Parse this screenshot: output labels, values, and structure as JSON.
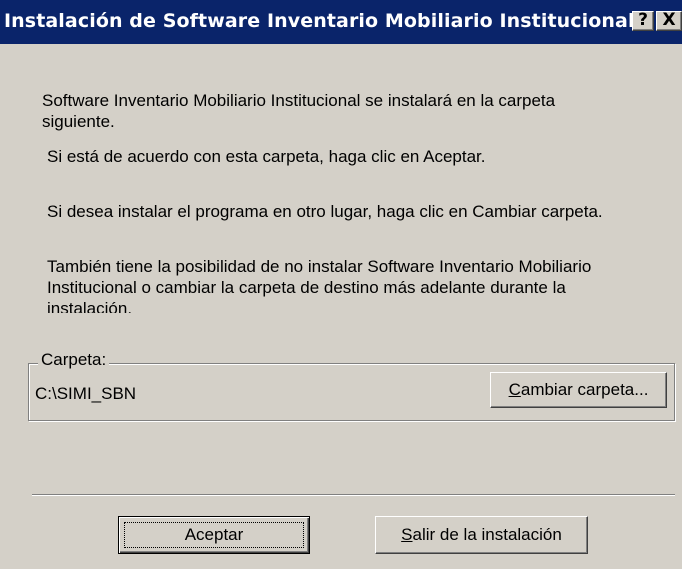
{
  "window": {
    "title": "Instalación de Software Inventario Mobiliario Institucional",
    "help_label": "?",
    "close_label": "X"
  },
  "message": {
    "line1": "Software Inventario Mobiliario Institucional se instalará en la carpeta",
    "line2": "siguiente.",
    "accept_hint": "Si está de acuerdo con esta carpeta, haga clic en Aceptar.",
    "change_hint": "Si desea instalar el programa en otro lugar, haga clic en Cambiar carpeta.",
    "skip_line1": "También tiene la posibilidad de no instalar Software Inventario Mobiliario",
    "skip_line2": "Institucional o cambiar la carpeta de destino más adelante durante la",
    "skip_line3": "instalación."
  },
  "folder": {
    "group_label": "Carpeta:",
    "path": "C:\\SIMI_SBN",
    "change_button": {
      "mnemonic": "C",
      "rest": "ambiar carpeta..."
    }
  },
  "buttons": {
    "ok_label": "Aceptar",
    "exit": {
      "mnemonic": "S",
      "rest": "alir de la instalación"
    }
  },
  "colors": {
    "titlebar": "#0a246a",
    "face": "#d4d0c8"
  }
}
